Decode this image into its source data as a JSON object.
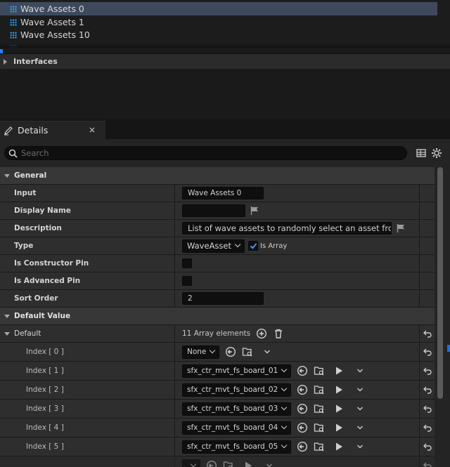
{
  "variables": {
    "items": [
      {
        "label": "Wave Assets 0",
        "selected": true
      },
      {
        "label": "Wave Assets 1",
        "selected": false
      },
      {
        "label": "Wave Assets 10",
        "selected": false
      }
    ]
  },
  "interfaces": {
    "label": "Interfaces"
  },
  "details_tab": {
    "label": "Details",
    "close": "×"
  },
  "search": {
    "placeholder": "Search"
  },
  "general": {
    "label": "General"
  },
  "props": {
    "input_label": "Input",
    "input_value": "Wave Assets 0",
    "display_name_label": "Display Name",
    "display_name_value": "",
    "description_label": "Description",
    "description_value": "List of wave assets to randomly select an asset from",
    "type_label": "Type",
    "type_value": "WaveAsset",
    "is_array_label": "Is Array",
    "is_array_checked": true,
    "constructor_pin_label": "Is Constructor Pin",
    "advanced_pin_label": "Is Advanced Pin",
    "sort_order_label": "Sort Order",
    "sort_order_value": "2"
  },
  "default_value": {
    "label": "Default Value"
  },
  "default": {
    "label": "Default",
    "count_text": "11 Array elements",
    "elements": [
      {
        "index": "Index [ 0 ]",
        "value": "None"
      },
      {
        "index": "Index [ 1 ]",
        "value": "sfx_ctr_mvt_fs_board_01"
      },
      {
        "index": "Index [ 2 ]",
        "value": "sfx_ctr_mvt_fs_board_02"
      },
      {
        "index": "Index [ 3 ]",
        "value": "sfx_ctr_mvt_fs_board_03"
      },
      {
        "index": "Index [ 4 ]",
        "value": "sfx_ctr_mvt_fs_board_04"
      },
      {
        "index": "Index [ 5 ]",
        "value": "sfx_ctr_mvt_fs_board_05"
      }
    ]
  },
  "colors": {
    "accent": "#2a7dff",
    "selection": "#3e4a5c",
    "panel": "#2e2e2e"
  }
}
